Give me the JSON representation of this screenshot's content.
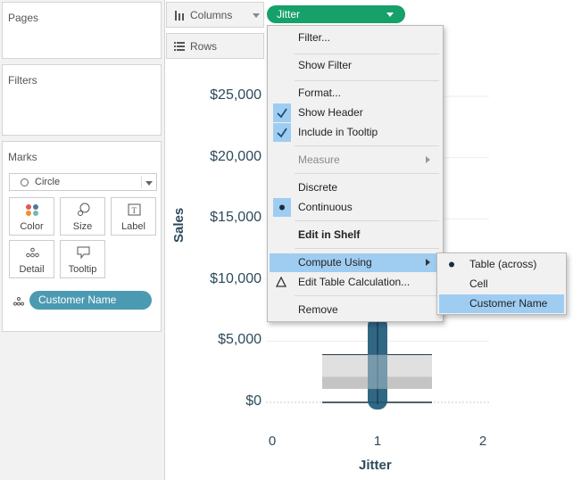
{
  "left": {
    "pages_title": "Pages",
    "filters_title": "Filters",
    "marks": {
      "title": "Marks",
      "mark_type": "Circle",
      "buttons": [
        {
          "label": "Color",
          "icon": "color-dots-icon"
        },
        {
          "label": "Size",
          "icon": "size-icon"
        },
        {
          "label": "Label",
          "icon": "label-icon"
        },
        {
          "label": "Detail",
          "icon": "detail-dots-icon"
        },
        {
          "label": "Tooltip",
          "icon": "tooltip-icon"
        }
      ],
      "pill": "Customer Name"
    }
  },
  "shelves": {
    "columns_label": "Columns",
    "rows_label": "Rows",
    "columns_pill": "Jitter"
  },
  "chart_data": {
    "type": "scatter",
    "ylabel": "Sales",
    "xlabel": "Jitter",
    "yticks": [
      "$25,000",
      "$20,000",
      "$15,000",
      "$10,000",
      "$5,000",
      "$0"
    ],
    "xticks": [
      "0",
      "1",
      "2"
    ],
    "ylim": [
      0,
      25000
    ],
    "xlim": [
      0,
      2
    ],
    "boxplot": {
      "x": 1,
      "lower_whisker": 0,
      "q1": 1100,
      "median": 2100,
      "q3": 3900
    },
    "points_x": 1,
    "point_range": [
      0,
      7000
    ],
    "colors": {
      "marks": "#1e5a78",
      "box_light": "#e0e0e0",
      "box_dark": "#c4c4c4"
    }
  },
  "menu": {
    "items": [
      {
        "label": "Filter..."
      },
      {
        "label": "Show Filter"
      },
      {
        "label": "Format..."
      },
      {
        "label": "Show Header",
        "check": "true"
      },
      {
        "label": "Include in Tooltip",
        "check": "true"
      },
      {
        "label": "Measure",
        "disabled": "true"
      },
      {
        "label": "Discrete"
      },
      {
        "label": "Continuous",
        "bullet": "true"
      },
      {
        "label": "Edit in Shelf",
        "bold": "true"
      },
      {
        "label": "Compute Using",
        "highlighted": "true"
      },
      {
        "label": "Edit Table Calculation...",
        "icon": "delta-icon"
      },
      {
        "label": "Remove"
      }
    ],
    "submenu": [
      {
        "label": "Table (across)",
        "bullet": "true"
      },
      {
        "label": "Cell"
      },
      {
        "label": "Customer Name",
        "highlighted": "true"
      }
    ]
  },
  "colors": {
    "jitter_pill": "#16a06a",
    "customer_pill": "#4b9ab2",
    "menu_highlight": "#9fcdf2"
  }
}
